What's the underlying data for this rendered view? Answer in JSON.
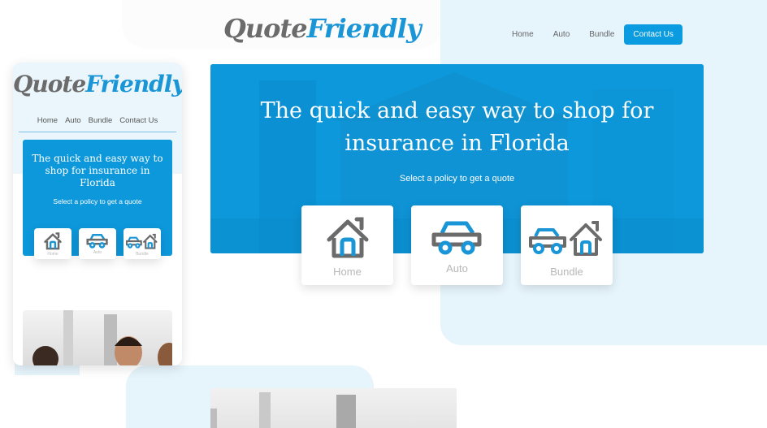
{
  "brand": {
    "part1": "Quote",
    "part2": "Friendly",
    "gray": "#6b6b6b",
    "blue": "#1a95d6"
  },
  "nav": {
    "items": [
      "Home",
      "Auto",
      "Bundle"
    ],
    "cta": "Contact Us",
    "mobile_items": [
      "Home",
      "Auto",
      "Bundle",
      "Contact Us"
    ]
  },
  "hero": {
    "title": "The quick and easy way to shop for insurance in Florida",
    "subtitle": "Select a policy to get a quote",
    "accent": "#0d98db"
  },
  "policies": [
    {
      "label": "Home",
      "icon": "house-icon"
    },
    {
      "label": "Auto",
      "icon": "car-icon"
    },
    {
      "label": "Bundle",
      "icon": "car-and-house-icon"
    }
  ]
}
